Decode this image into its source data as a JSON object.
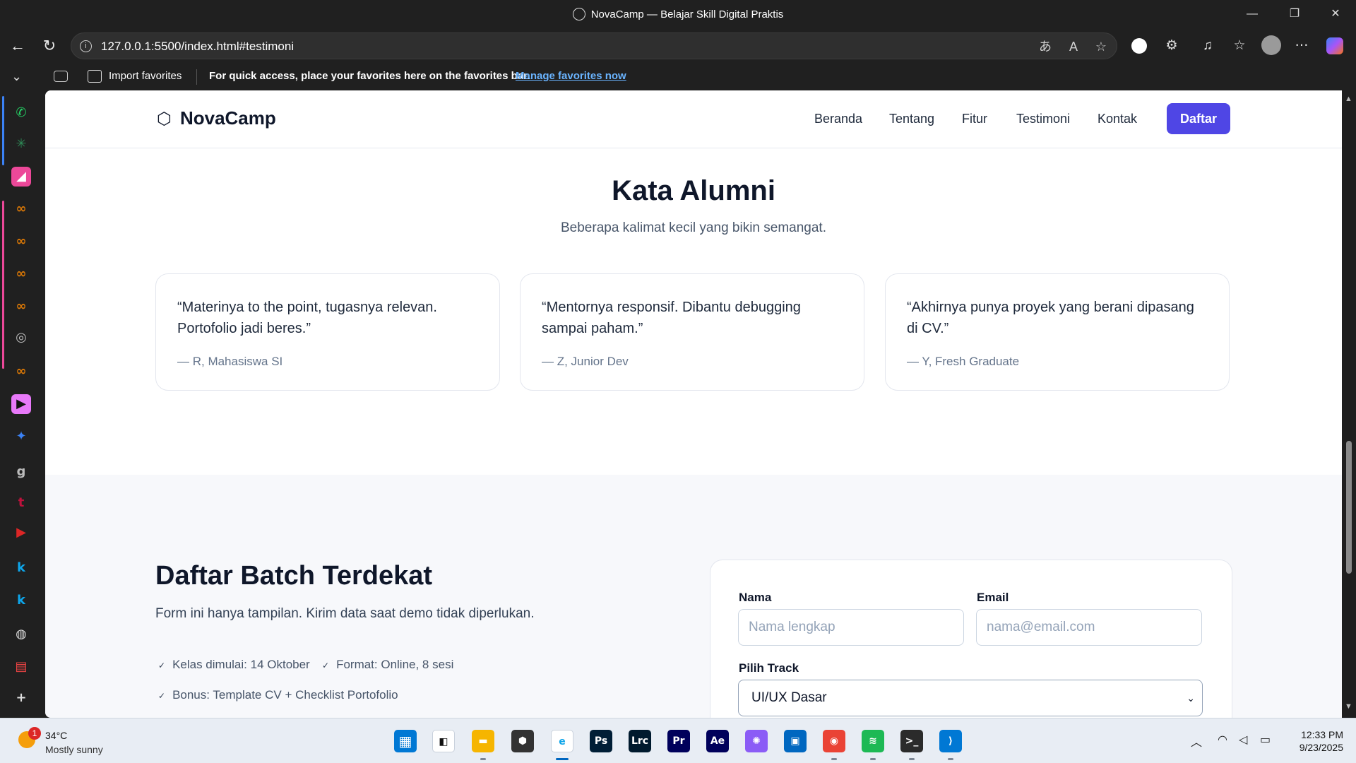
{
  "window": {
    "title": "NovaCamp — Belajar Skill Digital Praktis",
    "minimize_glyph": "—",
    "restore_glyph": "❐",
    "close_glyph": "✕"
  },
  "browser": {
    "back_glyph": "←",
    "reload_glyph": "↻",
    "url": "127.0.0.1:5500/index.html#testimoni",
    "info_glyph": "i",
    "translate_glyph": "あ",
    "read_aloud_glyph": "A",
    "favorite_glyph": "☆",
    "toolbar_glyphs": {
      "extensions": "⚙",
      "collections": "♫",
      "favorites": "☆",
      "more": "⋯"
    }
  },
  "favorites_bar": {
    "import_label": "Import favorites",
    "hint": "For quick access, place your favorites here on the favorites bar.",
    "manage_link": "Manage favorites now"
  },
  "sidebar": {
    "toggle_glyph": "⌄",
    "items": [
      {
        "glyph": "✆",
        "color": "#25d366"
      },
      {
        "glyph": "✳",
        "color": "#2e8b57"
      },
      {
        "glyph": "◢",
        "color": "#ffffff",
        "bg": "#ec4899"
      },
      {
        "glyph": "∞",
        "color": "#d97706"
      },
      {
        "glyph": "∞",
        "color": "#d97706"
      },
      {
        "glyph": "∞",
        "color": "#d97706"
      },
      {
        "glyph": "∞",
        "color": "#d97706"
      },
      {
        "glyph": "◎",
        "color": "#bbbbbb"
      },
      {
        "glyph": "∞",
        "color": "#d97706"
      },
      {
        "glyph": "▶",
        "color": "#111111",
        "bg": "#e879f9"
      },
      {
        "glyph": "✦",
        "color": "#3b82f6"
      },
      {
        "glyph": "g",
        "color": "#bbbbbb"
      },
      {
        "glyph": "t",
        "color": "#be123c"
      },
      {
        "glyph": "▶",
        "color": "#dc2626"
      },
      {
        "glyph": "k",
        "color": "#0ea5e9"
      },
      {
        "glyph": "k",
        "color": "#0ea5e9"
      },
      {
        "glyph": "◍",
        "color": "#dddddd"
      },
      {
        "glyph": "▤",
        "color": "#ef4444"
      },
      {
        "glyph": "+",
        "color": "#dddddd"
      }
    ]
  },
  "site": {
    "logo_icon": "⬡",
    "logo_text": "NovaCamp",
    "nav": [
      "Beranda",
      "Tentang",
      "Fitur",
      "Testimoni",
      "Kontak"
    ],
    "cta": "Daftar",
    "testimonials": {
      "title": "Kata Alumni",
      "subtitle": "Beberapa kalimat kecil yang bikin semangat.",
      "items": [
        {
          "quote": "“Materinya to the point, tugasnya relevan. Portofolio jadi beres.”",
          "author": "— R, Mahasiswa SI"
        },
        {
          "quote": "“Mentornya responsif. Dibantu debugging sampai paham.”",
          "author": "— Z, Junior Dev"
        },
        {
          "quote": "“Akhirnya punya proyek yang berani dipasang di CV.”",
          "author": "— Y, Fresh Graduate"
        }
      ]
    },
    "register": {
      "title": "Daftar Batch Terdekat",
      "subtitle": "Form ini hanya tampilan. Kirim data saat demo tidak diperlukan.",
      "tick_glyph": "✓",
      "bullets": [
        "Kelas dimulai: 14 Oktober",
        "Format: Online, 8 sesi",
        "Bonus: Template CV + Checklist Portofolio"
      ],
      "form": {
        "name_label": "Nama",
        "name_placeholder": "Nama lengkap",
        "email_label": "Email",
        "email_placeholder": "nama@email.com",
        "track_label": "Pilih Track",
        "track_value": "UI/UX Dasar",
        "chevron_glyph": "⌄"
      }
    }
  },
  "taskbar": {
    "weather_badge": "1",
    "temperature": "34°C",
    "condition": "Mostly sunny",
    "apps": [
      {
        "name": "start",
        "glyph": "▦",
        "color": "#0078d4"
      },
      {
        "name": "task-view",
        "glyph": "◧",
        "color": "#111111"
      },
      {
        "name": "file-explorer",
        "glyph": "▬",
        "color": "#f6b500"
      },
      {
        "name": "obs",
        "glyph": "⬢",
        "color": "#333333"
      },
      {
        "name": "edge",
        "glyph": "e",
        "color": "#0ea5e9"
      },
      {
        "name": "photoshop",
        "glyph": "Ps",
        "color": "#001e36"
      },
      {
        "name": "lightroom-classic",
        "glyph": "Lrc",
        "color": "#001a2e"
      },
      {
        "name": "premiere",
        "glyph": "Pr",
        "color": "#00005b"
      },
      {
        "name": "after-effects",
        "glyph": "Ae",
        "color": "#00005b"
      },
      {
        "name": "m365-copilot",
        "glyph": "✺",
        "color": "#8b5cf6"
      },
      {
        "name": "store",
        "glyph": "▣",
        "color": "#0067c0"
      },
      {
        "name": "chrome",
        "glyph": "◉",
        "color": "#ea4335"
      },
      {
        "name": "spotify",
        "glyph": "≋",
        "color": "#1db954"
      },
      {
        "name": "terminal",
        "glyph": ">_",
        "color": "#2b2b2b"
      },
      {
        "name": "vscode",
        "glyph": "⟩",
        "color": "#0078d4"
      }
    ],
    "tray_glyphs": {
      "chevron": "︿",
      "wifi": "◠",
      "volume": "◁",
      "battery": "▭"
    },
    "time": "12:33 PM",
    "date": "9/23/2025"
  },
  "colors": {
    "brand": "#4f46e5",
    "heading": "#0f172a",
    "muted": "#64748b",
    "section_bg": "#f7f8fb"
  }
}
